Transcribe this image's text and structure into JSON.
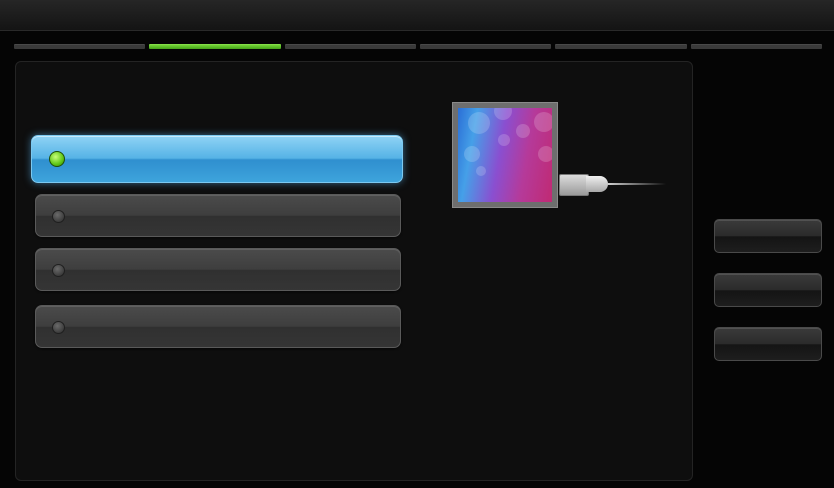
{
  "window": {
    "title": ""
  },
  "progress": {
    "total_steps": 6,
    "current_step": 2
  },
  "options": [
    {
      "label": "",
      "selected": true
    },
    {
      "label": "",
      "selected": false
    },
    {
      "label": "",
      "selected": false
    },
    {
      "label": "",
      "selected": false
    }
  ],
  "preview": {
    "icon": "monitor-with-network-cable-icon"
  },
  "side_buttons": [
    {
      "label": ""
    },
    {
      "label": ""
    },
    {
      "label": ""
    }
  ],
  "colors": {
    "accent_blue": "#3ea4dc",
    "active_step_green": "#45a31a",
    "radio_selected": "#5fc616",
    "background": "#050505"
  }
}
